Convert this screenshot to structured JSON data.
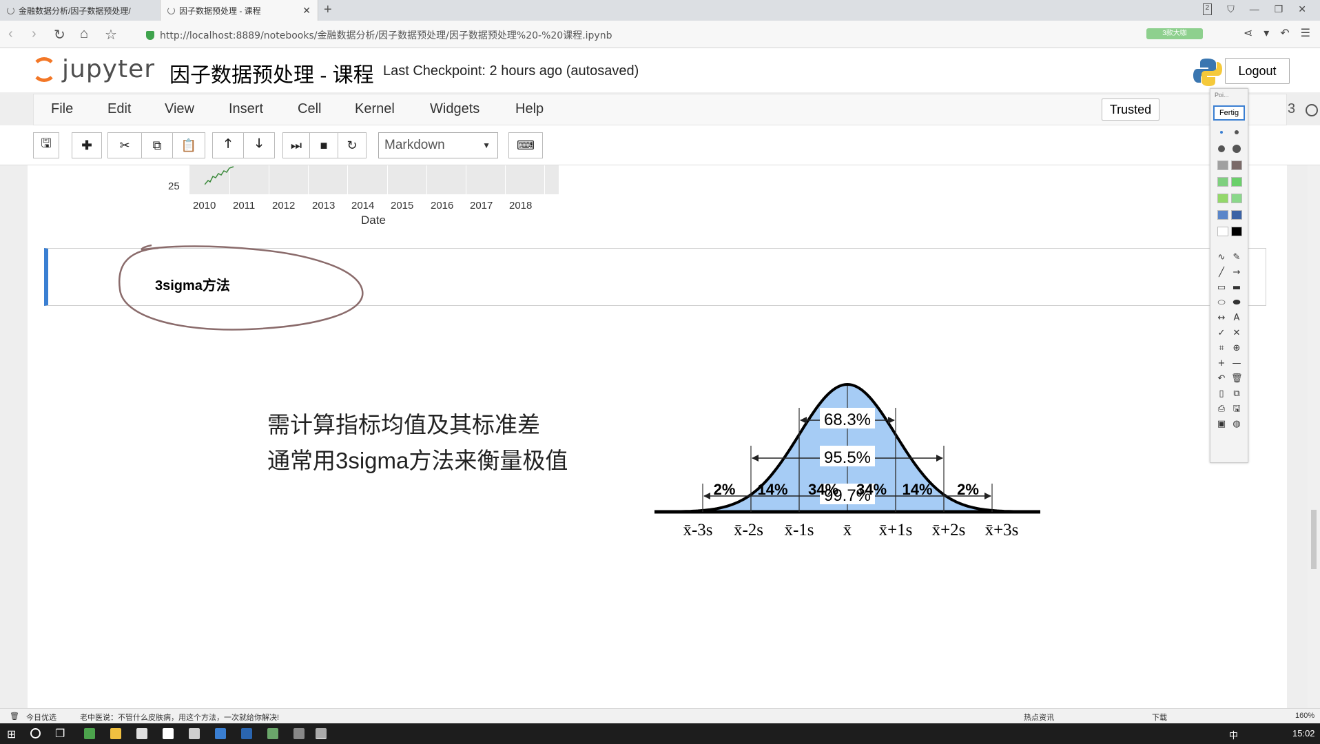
{
  "browser": {
    "tabs": [
      {
        "label": "金融数据分析/因子数据预处理/"
      },
      {
        "label": "因子数据预处理 - 课程"
      }
    ],
    "new_tab_icon": "plus-icon",
    "tab_counter": "2",
    "url": "http://localhost:8889/notebooks/金融数据分析/因子数据预处理/因子数据预处理%20-%20课程.ipynb",
    "extension_badge": "3款大咖"
  },
  "jupyter": {
    "logo_text": "jupyter",
    "notebook_title": "因子数据预处理 - 课程",
    "checkpoint": "Last Checkpoint: 2 hours ago (autosaved)",
    "logout_label": "Logout",
    "menu": [
      "File",
      "Edit",
      "View",
      "Insert",
      "Cell",
      "Kernel",
      "Widgets",
      "Help"
    ],
    "trusted_label": "Trusted",
    "kernel_fragment": "3",
    "cell_type": "Markdown"
  },
  "output_chart": {
    "ytick": "25",
    "xticks": [
      "2010",
      "2011",
      "2012",
      "2013",
      "2014",
      "2015",
      "2016",
      "2017",
      "2018"
    ],
    "xlabel": "Date"
  },
  "markdown_cell": {
    "heading": "3sigma方法"
  },
  "content": {
    "line1": "需计算指标均值及其标准差",
    "line2": "通常用3sigma方法来衡量极值"
  },
  "chart_data": {
    "type": "area",
    "title": "",
    "interval_labels": [
      "68.3%",
      "95.5%",
      "99.7%"
    ],
    "segments": [
      "2%",
      "14%",
      "34%",
      "34%",
      "14%",
      "2%"
    ],
    "x_labels": [
      "x̄-3s",
      "x̄-2s",
      "x̄-1s",
      "x̄",
      "x̄+1s",
      "x̄+2s",
      "x̄+3s"
    ],
    "fill_color": "#a6ccf5",
    "curve_color": "#000000"
  },
  "pen_tool": {
    "title_fragment": "Poi...",
    "done_label": "Fertig"
  },
  "statusbar": {
    "left_label": "今日优选",
    "ad_text": "老中医说：不管什么皮肤病，用这个方法，一次就给你解决!",
    "hot_label": "热点资讯",
    "download_label": "下载",
    "zoom": "160%"
  },
  "taskbar": {
    "ime": "中",
    "clock": "15:02"
  }
}
